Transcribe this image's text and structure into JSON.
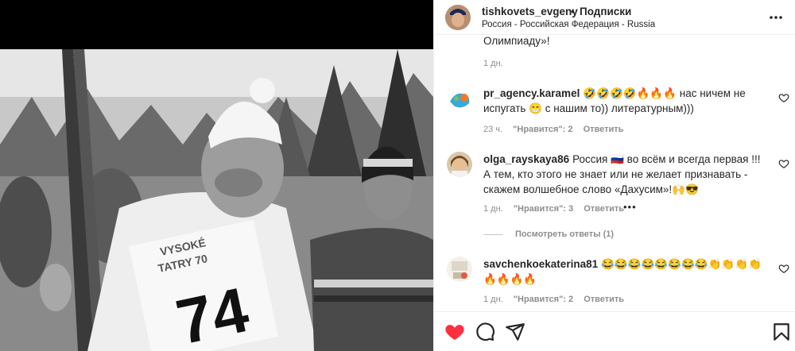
{
  "header": {
    "username": "tishkovets_evgeny",
    "dot": "•",
    "follow_label": "Подписки",
    "location": "Россия - Российская Федерация - Russia"
  },
  "prev_comment": {
    "cut_text": "Олимпиаду»!",
    "time": "1 дн."
  },
  "comments": [
    {
      "username": "pr_agency.karamel",
      "text": "🤣🤣🤣🤣🔥🔥🔥 нас ничем не испугать 😁 с нашим то)) литературным)))",
      "time": "23 ч.",
      "likes": "\"Нравится\": 2",
      "reply": "Ответить"
    },
    {
      "username": "olga_rayskaya86",
      "text": "Россия 🇷🇺 во всём и всегда первая !!! А тем, кто этого не знает или не желает признавать - скажем волшебное слово «Дахусим»!🙌😎",
      "time": "1 дн.",
      "likes": "\"Нравится\": 3",
      "reply": "Ответить",
      "more": "•••",
      "view_replies": "Посмотреть ответы (1)"
    },
    {
      "username": "savchenkoekaterina81",
      "text": "😂😂😂😂😂😂😂😂👏👏👏👏🔥🔥🔥🔥",
      "time": "1 дн.",
      "likes": "\"Нравится\": 2",
      "reply": "Ответить"
    }
  ],
  "photo": {
    "bib_number": "74",
    "bib_top_text": "VYSOKÉ",
    "bib_mid_text": "TATRY 70"
  },
  "colors": {
    "like_red": "#ff3040",
    "text": "#262626",
    "muted": "#8e8e8e"
  },
  "icons": [
    "more-options-icon",
    "heart-filled-icon",
    "comment-icon",
    "share-icon",
    "bookmark-icon",
    "comment-like-icon"
  ]
}
